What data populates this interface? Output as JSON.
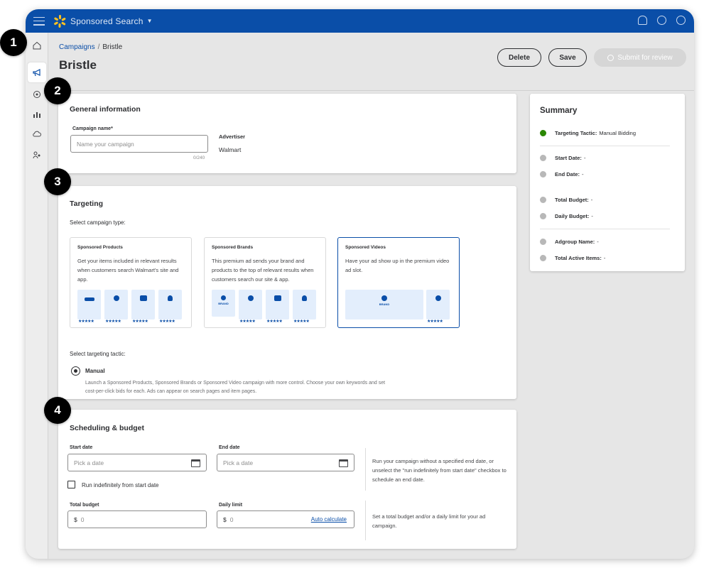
{
  "app": {
    "name": "Sponsored Search"
  },
  "breadcrumb": {
    "parent": "Campaigns",
    "separator": "/",
    "current": "Bristle"
  },
  "page": {
    "title": "Bristle"
  },
  "actions": {
    "delete": "Delete",
    "save": "Save",
    "submit": "Submit for review"
  },
  "general": {
    "title": "General information",
    "campaign_name_label": "Campaign name*",
    "campaign_name_placeholder": "Name your campaign",
    "char_count": "0/240",
    "advertiser_label": "Advertiser",
    "advertiser_value": "Walmart"
  },
  "targeting": {
    "title": "Targeting",
    "select_type_label": "Select campaign type:",
    "types": [
      {
        "title": "Sponsored Products",
        "desc": "Get your items included in relevant results when customers search Walmart's site and app."
      },
      {
        "title": "Sponsored Brands",
        "desc": "This premium ad sends your brand and products to the top of relevant results when customers search our site & app."
      },
      {
        "title": "Sponsored Videos",
        "desc": "Have your ad show up in the premium video ad slot."
      }
    ],
    "brand_tag": "BRAND",
    "stars": "★★★★★",
    "tactic_label": "Select targeting tactic:",
    "tactic_option": "Manual",
    "tactic_desc_1": "Launch a Sponsored Products, Sponsored Brands or Sponsored Video campaign with more control. Choose your own keywords and set",
    "tactic_desc_2": "cost-per-click bids for each. Ads can appear on search pages and item pages."
  },
  "scheduling": {
    "title": "Scheduling & budget",
    "start_label": "Start date",
    "end_label": "End date",
    "date_placeholder": "Pick a date",
    "indefinite_label": "Run indefinitely from start date",
    "date_help": "Run your campaign without a specified end date, or unselect the \"run indefinitely from start date\" checkbox to schedule an end date.",
    "total_label": "Total budget",
    "daily_label": "Daily limit",
    "currency": "$",
    "amount_placeholder": "0",
    "auto_calc": "Auto calculate",
    "budget_help": "Set a total budget and/or a daily limit for your ad campaign."
  },
  "summary": {
    "title": "Summary",
    "tactic_label": "Targeting Tactic:",
    "tactic_value": "Manual Bidding",
    "start_label": "Start Date:",
    "end_label": "End Date:",
    "total_label": "Total Budget:",
    "daily_label": "Daily Budget:",
    "adgroup_label": "Adgroup Name:",
    "items_label": "Total Active Items:",
    "empty": "-"
  },
  "steps": [
    "1",
    "2",
    "3",
    "4"
  ],
  "colors": {
    "brand_blue": "#0a4ea8",
    "spark_yellow": "#ffc220",
    "success_green": "#2a8703"
  }
}
